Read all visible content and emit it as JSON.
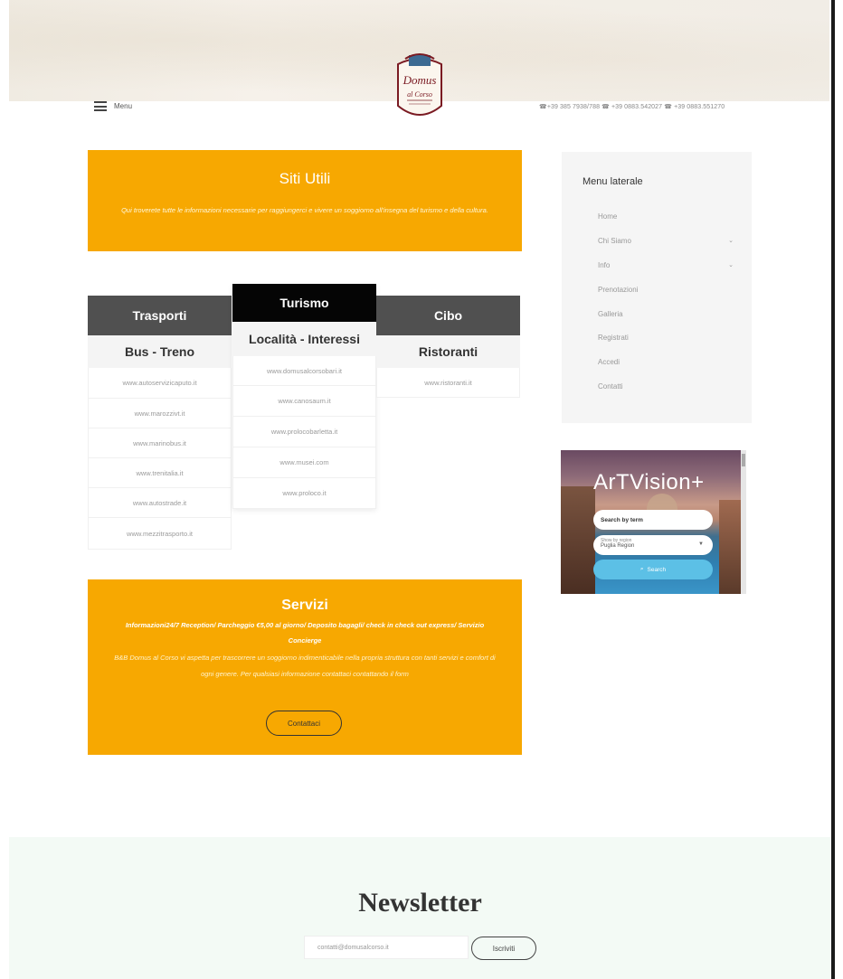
{
  "header": {
    "menu_label": "Menu",
    "phones": "☎+39 385 7938/788 ☎ +39 0883.542027 ☎ +39 0883.551270",
    "logo_line1": "Domus",
    "logo_line2": "al Corso"
  },
  "siti_utili": {
    "title": "Siti Utili",
    "description": "Qui troverete tutte le informazioni necessarie per raggiungerci e vivere un soggiorno all'insegna del turismo e della cultura."
  },
  "columns": [
    {
      "header": "Trasporti",
      "subheader": "Bus - Treno",
      "links": [
        "www.autoservizicaputo.it",
        "www.marozzivt.it",
        "www.marinobus.it",
        "www.trenitalia.it",
        "www.autostrade.it",
        "www.mezzitrasporto.it"
      ]
    },
    {
      "header": "Turismo",
      "subheader": "Località - Interessi",
      "links": [
        "www.domusalcorsobari.it",
        "www.canosaum.it",
        "www.prolocobarletta.it",
        "www.musei.com",
        "www.proloco.it"
      ]
    },
    {
      "header": "Cibo",
      "subheader": "Ristoranti",
      "links": [
        "www.ristoranti.it"
      ]
    }
  ],
  "servizi": {
    "title": "Servizi",
    "highlights": "Informazioni24/7 Reception/ Parcheggio  €5,00 al giorno/ Deposito bagagli/ check in check out express/ Servizio Concierge",
    "description": "B&B Domus al Corso vi aspetta per trascorrere un soggiorno indimenticabile nella propria struttura con tanti servizi e comfort di ogni genere. Per qualsiasi informazione contattaci contattando il form",
    "button_label": "Contattaci"
  },
  "sidebar": {
    "title": "Menu laterale",
    "items": [
      {
        "label": "Home",
        "has_submenu": false
      },
      {
        "label": "Chi Siamo",
        "has_submenu": true
      },
      {
        "label": "Info",
        "has_submenu": true
      },
      {
        "label": "Prenotazioni",
        "has_submenu": false
      },
      {
        "label": "Galleria",
        "has_submenu": false
      },
      {
        "label": "Registrati",
        "has_submenu": false
      },
      {
        "label": "Accedi",
        "has_submenu": false
      },
      {
        "label": "Contatti",
        "has_submenu": false
      }
    ]
  },
  "artvision": {
    "brand": "ArTVision+",
    "search_placeholder": "Search by term",
    "region_caption": "Show by region",
    "region_value": "Puglia Region",
    "button_label": "Search"
  },
  "newsletter": {
    "title": "Newsletter",
    "email_value": "contatti@domusalcorso.it",
    "button_label": "Iscriviti"
  },
  "colors": {
    "accent_orange": "#f7a801",
    "column_header": "#505050",
    "column_header_active": "#050505",
    "newsletter_bg": "#f3faf5"
  }
}
